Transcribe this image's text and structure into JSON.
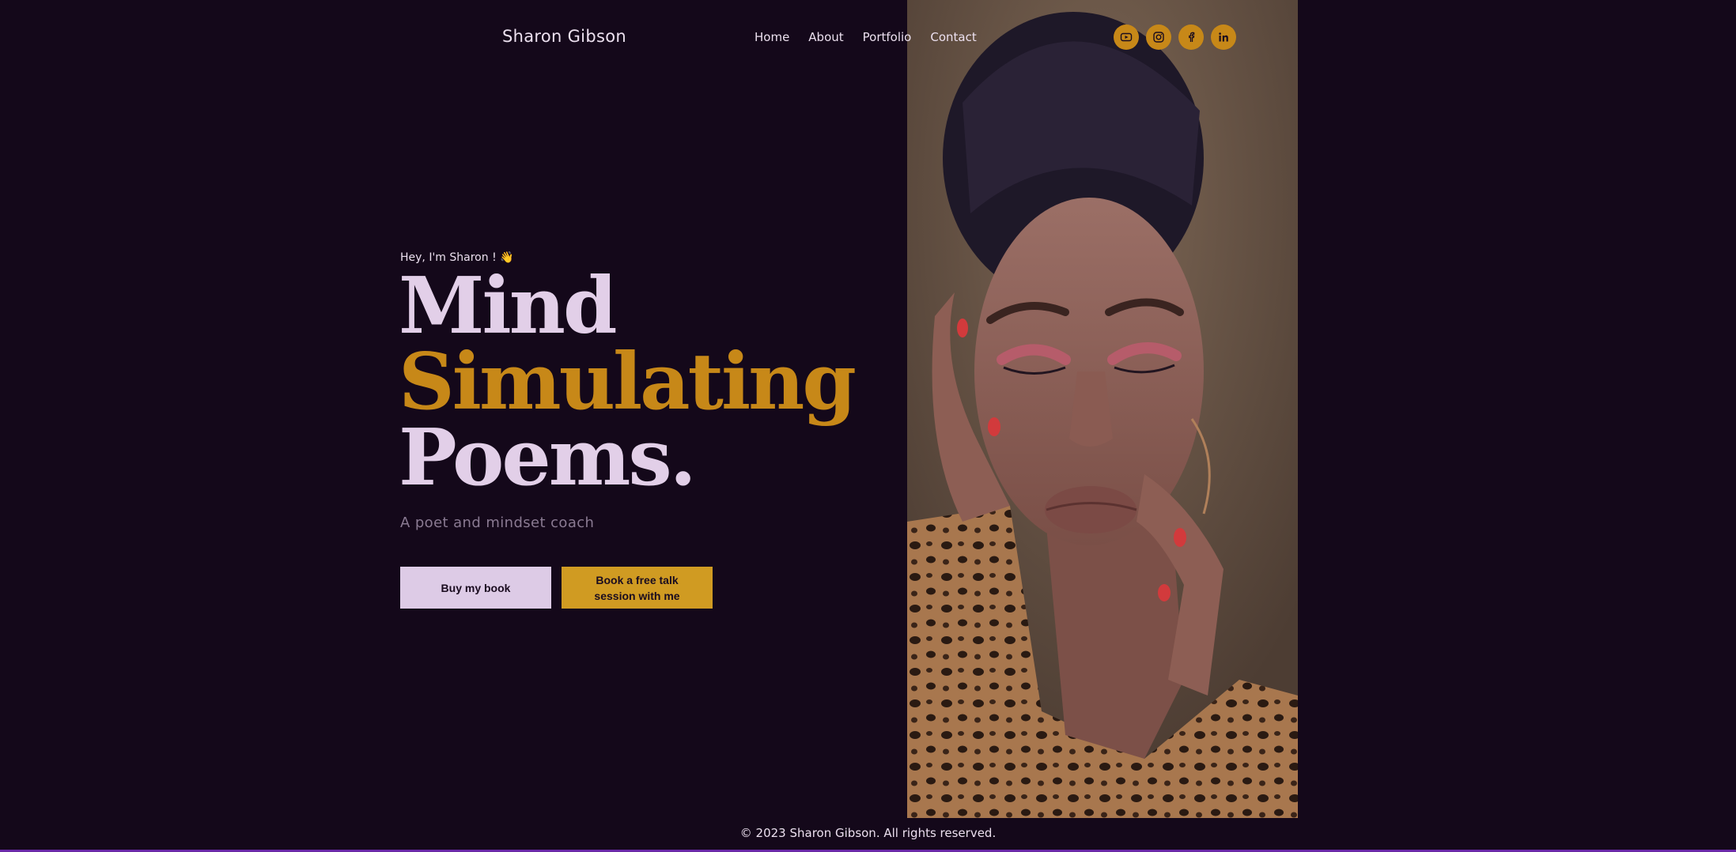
{
  "brand": "Sharon Gibson",
  "nav": [
    "Home",
    "About",
    "Portfolio",
    "Contact"
  ],
  "socials": [
    "youtube-icon",
    "instagram-icon",
    "facebook-icon",
    "linkedin-icon"
  ],
  "hero": {
    "greeting": "Hey, I'm Sharon ! 👋",
    "line1": "Mind",
    "line2": "Simulating",
    "line3": "Poems.",
    "subtitle": "A poet and mindset coach",
    "btn_primary": "Buy my book",
    "btn_secondary": "Book a free talk session with me"
  },
  "footer": "© 2023 Sharon Gibson. All rights reserved.",
  "colors": {
    "background": "#14081a",
    "accent": "#c78818",
    "light": "#e2cfe8"
  }
}
